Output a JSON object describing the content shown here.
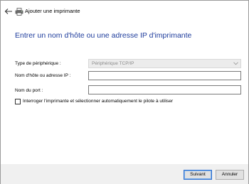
{
  "window": {
    "title": "Ajouter une imprimante",
    "heading": "Entrer un nom d'hôte ou une adresse IP d'imprimante"
  },
  "form": {
    "device_type_label": "Type de périphérique :",
    "device_type_value": "Périphérique TCP/IP",
    "hostname_label": "Nom d'hôte ou adresse IP :",
    "hostname_value": "",
    "port_label": "Nom du port :",
    "port_value": "",
    "autodetect_label": "Interroger l'imprimante et sélectionner automatiquement le pilote à utiliser",
    "autodetect_checked": false
  },
  "buttons": {
    "next_label": "Suivant",
    "cancel_label": "Annuler"
  },
  "colors": {
    "heading": "#1e3c9c",
    "primary_border": "#2e6fd0",
    "footer_bg": "#f0f0f0"
  },
  "icons": [
    "back-arrow-icon",
    "printer-icon",
    "chevron-down-icon"
  ]
}
